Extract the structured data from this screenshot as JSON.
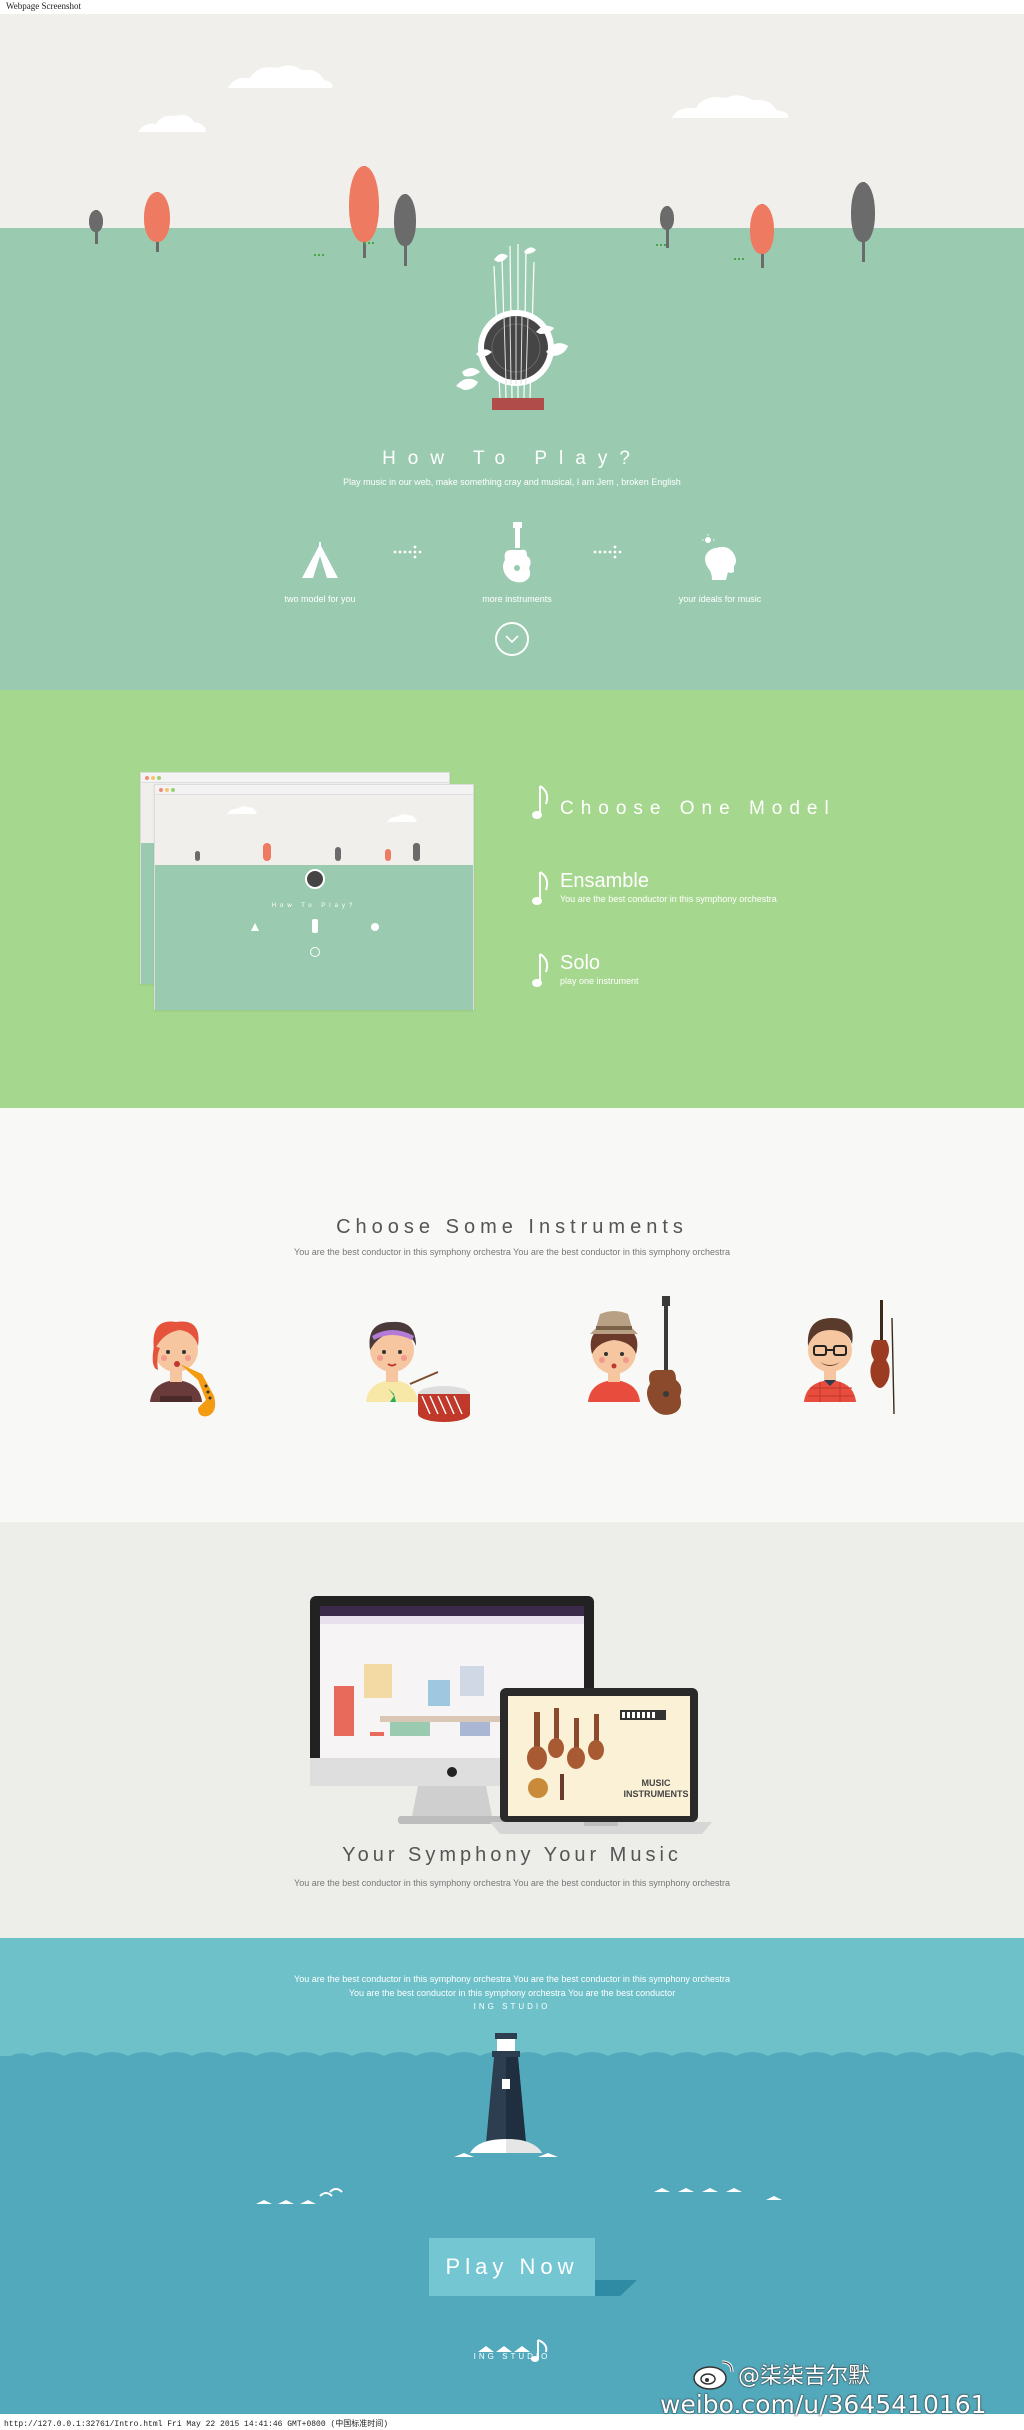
{
  "browser_caption": "Webpage Screenshot",
  "footer_caption": "http://127.0.0.1:32761/Intro.html  Fri May 22 2015 14:41:46 GMT+0800 (中国标准时间)",
  "colors": {
    "sky": "#f0efec",
    "grass": "#9acbb0",
    "model_bg": "#a6d78e",
    "instruments_bg": "#f8f8f6",
    "showcase_bg": "#ededea",
    "sea_top": "#6ec0c9",
    "sea": "#53a9bc",
    "tree_red": "#ee7a62",
    "tree_grey": "#6b6b6b",
    "text_dark": "#555555"
  },
  "hero": {
    "title": "How To Play?",
    "subtitle": "Play music in our web, make something cray and musical, I am Jem , broken English",
    "steps": [
      {
        "icon": "tent-icon",
        "label": "two model for you"
      },
      {
        "icon": "guitar-icon",
        "label": "more instruments"
      },
      {
        "icon": "head-idea-icon",
        "label": "your ideals for music"
      }
    ],
    "scroll_icon": "chevron-down-icon"
  },
  "models": {
    "heading": "Choose One Model",
    "items": [
      {
        "title": "Ensamble",
        "subtitle": "You are the best conductor in this symphony orchestra"
      },
      {
        "title": "Solo",
        "subtitle": "play one instrument"
      }
    ],
    "preview_title": "How To Play?"
  },
  "instruments": {
    "heading": "Choose Some  Instruments",
    "subtitle": "You are the best conductor in this symphony orchestra You are the best conductor in this symphony orchestra",
    "characters": [
      {
        "name": "saxophone-player",
        "instrument": "saxophone"
      },
      {
        "name": "drummer",
        "instrument": "drum"
      },
      {
        "name": "guitarist",
        "instrument": "guitar"
      },
      {
        "name": "violinist",
        "instrument": "violin"
      }
    ]
  },
  "showcase": {
    "heading": "Your Symphony Your Music",
    "subtitle": "You are the best conductor in this symphony orchestra You are the best conductor in this symphony orchestra",
    "laptop_screen_line1": "MUSIC",
    "laptop_screen_line2": "INSTRUMENTS"
  },
  "footer": {
    "line1": "You are the best conductor in this symphony orchestra You are the best conductor in this symphony orchestra",
    "line2": "You are the best conductor in this symphony orchestra You are the best conductor",
    "studio": "ING STUDIO",
    "cta": "Play Now",
    "bottom_studio": "ING STUDIO"
  },
  "watermark": {
    "id": "@柒柒吉尔默",
    "url": "weibo.com/u/3645410161"
  }
}
